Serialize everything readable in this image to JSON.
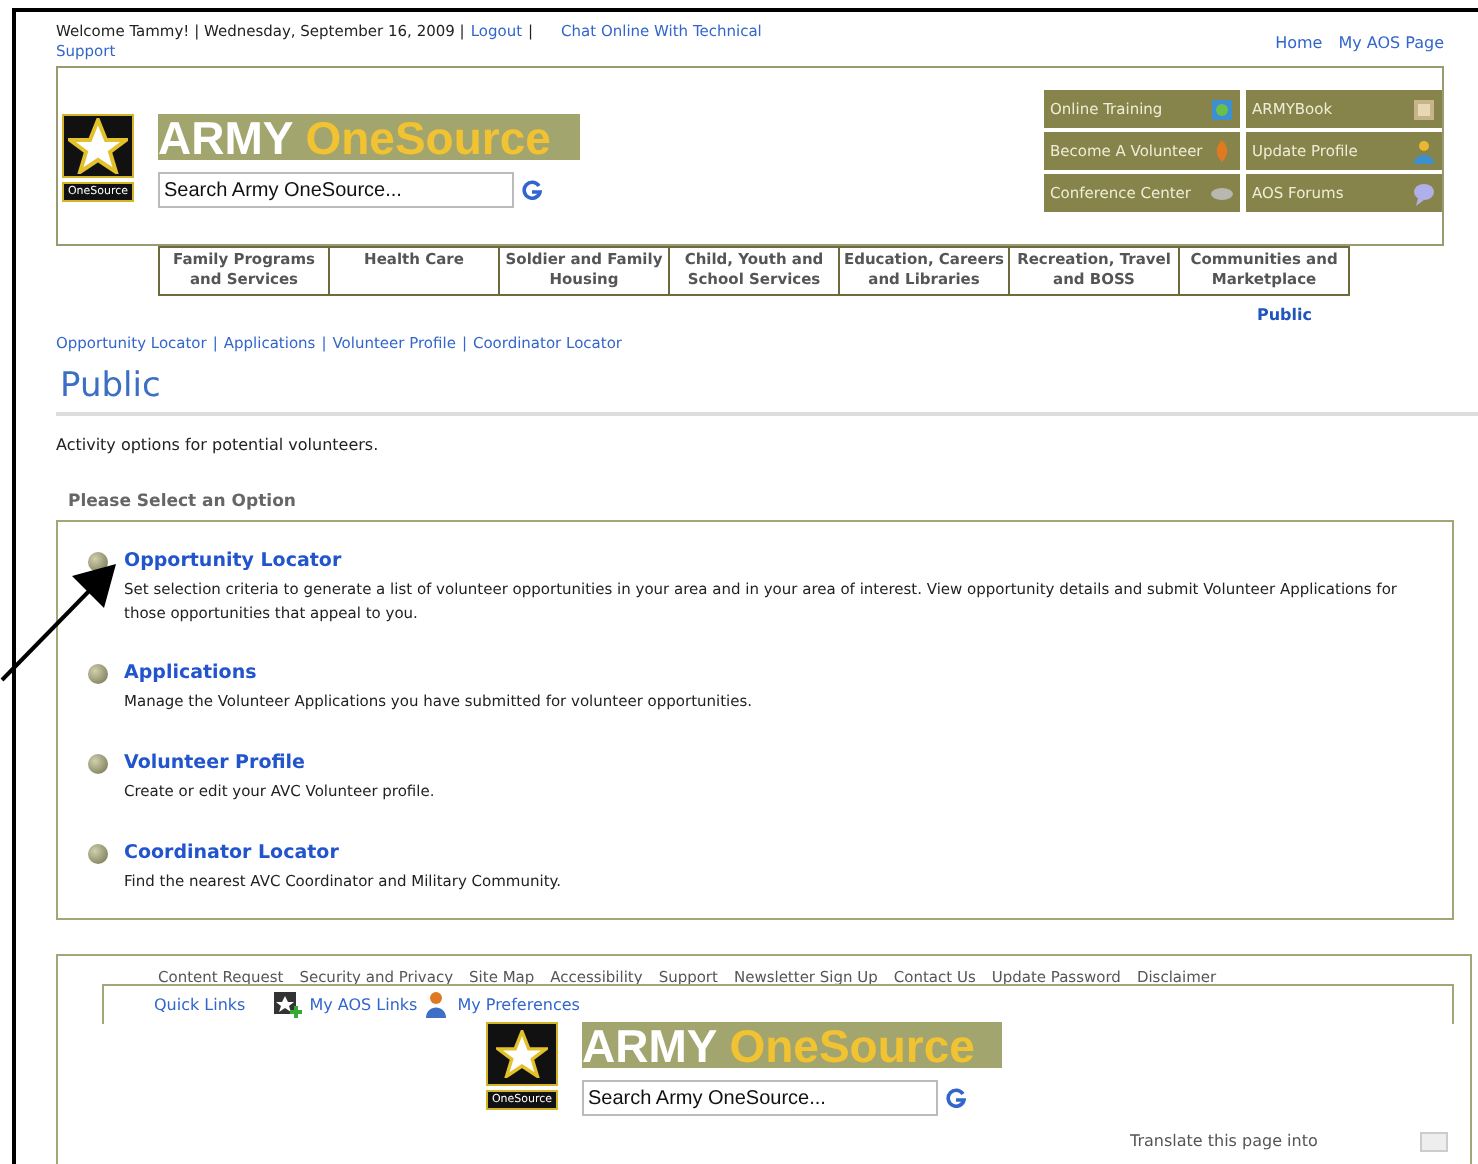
{
  "top_bar": {
    "welcome": "Welcome Tammy! | Wednesday, September 16, 2009 |",
    "logout": "Logout",
    "separator": "|",
    "chat": [
      "Chat Online With Technical",
      "Support"
    ],
    "links": [
      "Home",
      "My AOS Page"
    ]
  },
  "header": {
    "badge": "OneSource",
    "brand": [
      "ARMY",
      "OneSource"
    ],
    "search": {
      "value": "Search Army OneSource..."
    },
    "quick_buttons": [
      {
        "label": "Online Training",
        "kind": "monitor"
      },
      {
        "label": "ARMYBook",
        "kind": "book"
      },
      {
        "label": "Become A Volunteer",
        "kind": "flame"
      },
      {
        "label": "Update Profile",
        "kind": "person"
      },
      {
        "label": "Conference Center",
        "kind": "disc"
      },
      {
        "label": "AOS Forums",
        "kind": "bubble"
      }
    ]
  },
  "nav": [
    "Family Programs and Services",
    "Health Care",
    "Soldier and Family Housing",
    "Child, Youth and School Services",
    "Education, Careers and Libraries",
    "Recreation, Travel and BOSS",
    "Communities and Marketplace"
  ],
  "section_label": "Public",
  "breadcrumbs": {
    "items": [
      "Opportunity Locator",
      "Applications",
      "Volunteer Profile",
      "Coordinator Locator"
    ],
    "separator": "|"
  },
  "page_title": "Public",
  "intro": "Activity options for potential volunteers.",
  "options_heading": "Please Select an Option",
  "options": [
    {
      "title": "Opportunity Locator",
      "description": "Set selection criteria to generate a list of volunteer opportunities in your area and in your area of interest. View opportunity details and submit Volunteer Applications for those opportunities that appeal to you."
    },
    {
      "title": "Applications",
      "description": "Manage the Volunteer Applications you have submitted for volunteer opportunities."
    },
    {
      "title": "Volunteer Profile",
      "description": "Create or edit your AVC Volunteer profile."
    },
    {
      "title": "Coordinator Locator",
      "description": "Find the nearest AVC Coordinator and Military Community."
    }
  ],
  "footer": {
    "links": [
      "Content Request",
      "Security and Privacy",
      "Site Map",
      "Accessibility",
      "Support",
      "Newsletter Sign Up",
      "Contact Us",
      "Update Password",
      "Disclaimer"
    ],
    "quick_links": "Quick Links",
    "my_links": [
      "My AOS Links",
      "My Preferences"
    ],
    "badge": "OneSource",
    "brand": [
      "ARMY",
      "OneSource"
    ],
    "search": {
      "value": "Search Army OneSource..."
    },
    "translate": "Translate this page into"
  }
}
